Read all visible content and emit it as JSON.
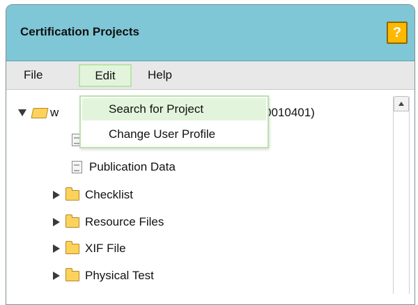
{
  "panel": {
    "title": "Certification Projects",
    "help_label": "?"
  },
  "menubar": {
    "items": [
      {
        "label": "File"
      },
      {
        "label": "Edit"
      },
      {
        "label": "Help"
      }
    ]
  },
  "dropdown": {
    "items": [
      {
        "label": "Search for Project",
        "highlighted": true
      },
      {
        "label": "Change User Profile",
        "highlighted": false
      }
    ]
  },
  "tree": {
    "root": {
      "visible_prefix": "w",
      "visible_suffix": "0010401)",
      "expanded": true
    },
    "children": [
      {
        "label": "Publication Data",
        "type": "document"
      },
      {
        "label": "Checklist",
        "type": "folder"
      },
      {
        "label": "Resource Files",
        "type": "folder"
      },
      {
        "label": "XIF File",
        "type": "folder"
      },
      {
        "label": "Physical Test",
        "type": "folder"
      }
    ]
  },
  "colors": {
    "title_bar": "#7fc6d6",
    "help_button": "#ffb800",
    "menu_highlight": "#e3f4dc",
    "menu_highlight_border": "#b9e4a8",
    "folder": "#fcd25a"
  }
}
